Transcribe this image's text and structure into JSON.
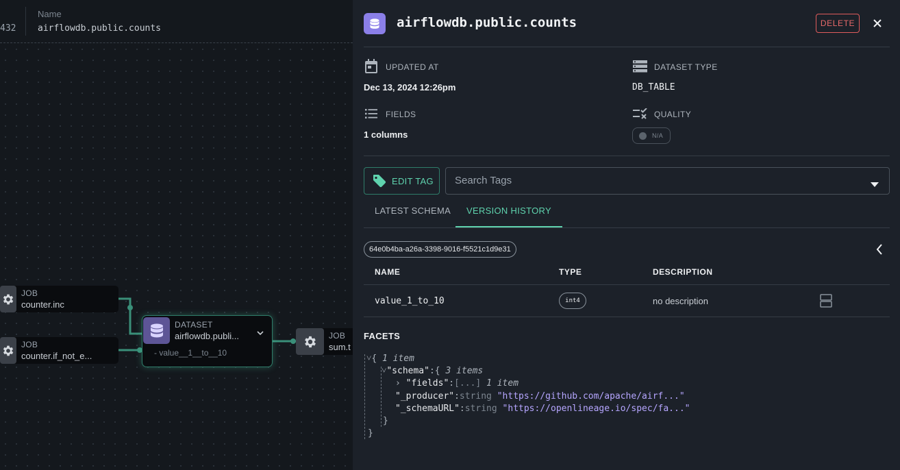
{
  "canvas": {
    "header": {
      "number_fragment": "432",
      "name_label": "Name",
      "name_value": "airflowdb.public.counts"
    },
    "nodes": {
      "job1": {
        "kind": "JOB",
        "name": "counter.inc"
      },
      "job2": {
        "kind": "JOB",
        "name": "counter.if_not_e..."
      },
      "dataset": {
        "kind": "DATASET",
        "name": "airflowdb.publi...",
        "field": "- value__1__to__10"
      },
      "job3": {
        "kind": "JOB",
        "name": "sum.t"
      }
    }
  },
  "drawer": {
    "title": "airflowdb.public.counts",
    "delete_label": "DELETE",
    "meta": {
      "updated_at_label": "UPDATED AT",
      "updated_at_value": "Dec 13, 2024 12:26pm",
      "dataset_type_label": "DATASET TYPE",
      "dataset_type_value": "DB_TABLE",
      "fields_label": "FIELDS",
      "fields_value": "1 columns",
      "quality_label": "QUALITY",
      "quality_value": "N/A"
    },
    "edit_tag_label": "EDIT TAG",
    "search_tags_placeholder": "Search Tags",
    "tabs": [
      {
        "label": "LATEST SCHEMA",
        "active": false
      },
      {
        "label": "VERSION HISTORY",
        "active": true
      }
    ],
    "version_id": "64e0b4ba-a26a-3398-9016-f5521c1d9e31",
    "table": {
      "headers": [
        "NAME",
        "TYPE",
        "DESCRIPTION"
      ],
      "rows": [
        {
          "name": "value_1_to_10",
          "type": "int4",
          "description": "no description"
        }
      ]
    },
    "facets": {
      "title": "FACETS",
      "json": {
        "root_count": "1 item",
        "schema_key": "\"schema\"",
        "schema_count": "3 items",
        "fields_key": "\"fields\"",
        "fields_preview": "[...]",
        "fields_count": "1 item",
        "producer_key": "\"_producer\"",
        "producer_type": "string",
        "producer_value": "\"https://github.com/apache/airf...\"",
        "schemaurl_key": "\"_schemaURL\"",
        "schemaurl_type": "string",
        "schemaurl_value": "\"https://openlineage.io/spec/fa...\""
      }
    }
  },
  "colors": {
    "accent": "#5fd3ae",
    "danger": "#e05c5c",
    "dataset": "#8b7fe8"
  }
}
